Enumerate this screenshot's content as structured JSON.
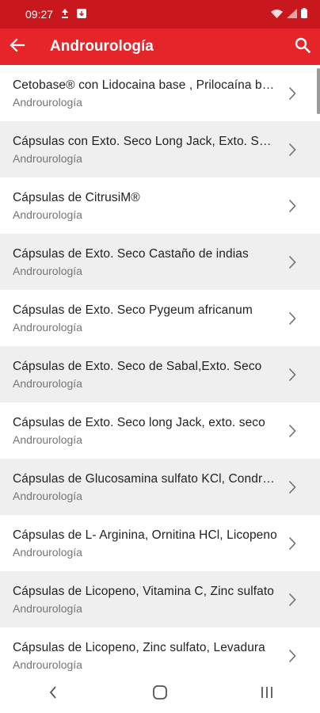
{
  "status_bar": {
    "time": "09:27",
    "icons": [
      "upload-icon",
      "download-icon",
      "wifi-icon",
      "signal-icon",
      "battery-icon"
    ]
  },
  "app_bar": {
    "title": "Androurología",
    "back_icon": "arrow-left-icon",
    "search_icon": "search-icon",
    "color": "#e5252a"
  },
  "items": [
    {
      "title": "Cetobase® con Lidocaina base , Prilocaína base",
      "subtitle": "Androurología"
    },
    {
      "title": "Cápsulas con Exto. Seco Long Jack, Exto. Seco",
      "subtitle": "Androurología"
    },
    {
      "title": "Cápsulas de CitrusiM®",
      "subtitle": "Androurología"
    },
    {
      "title": "Cápsulas de Exto. Seco Castaño de indias",
      "subtitle": "Androurología"
    },
    {
      "title": "Cápsulas de Exto. Seco Pygeum africanum",
      "subtitle": "Androurología"
    },
    {
      "title": "Cápsulas de Exto. Seco de Sabal,Exto. Seco",
      "subtitle": "Androurología"
    },
    {
      "title": "Cápsulas de Exto. Seco long Jack, exto. seco",
      "subtitle": "Androurología"
    },
    {
      "title": "Cápsulas de Glucosamina sulfato KCl, Condroitina",
      "subtitle": "Androurología"
    },
    {
      "title": "Cápsulas de L- Arginina, Ornitina HCl, Licopeno",
      "subtitle": "Androurología"
    },
    {
      "title": "Cápsulas de Licopeno, Vitamina C, Zinc sulfato",
      "subtitle": "Androurología"
    },
    {
      "title": "Cápsulas de Licopeno, Zinc sulfato, Levadura",
      "subtitle": "Androurología"
    }
  ],
  "nav_bar": {
    "back_icon": "nav-back-icon",
    "home_icon": "nav-home-icon",
    "recents_icon": "nav-recents-icon"
  }
}
